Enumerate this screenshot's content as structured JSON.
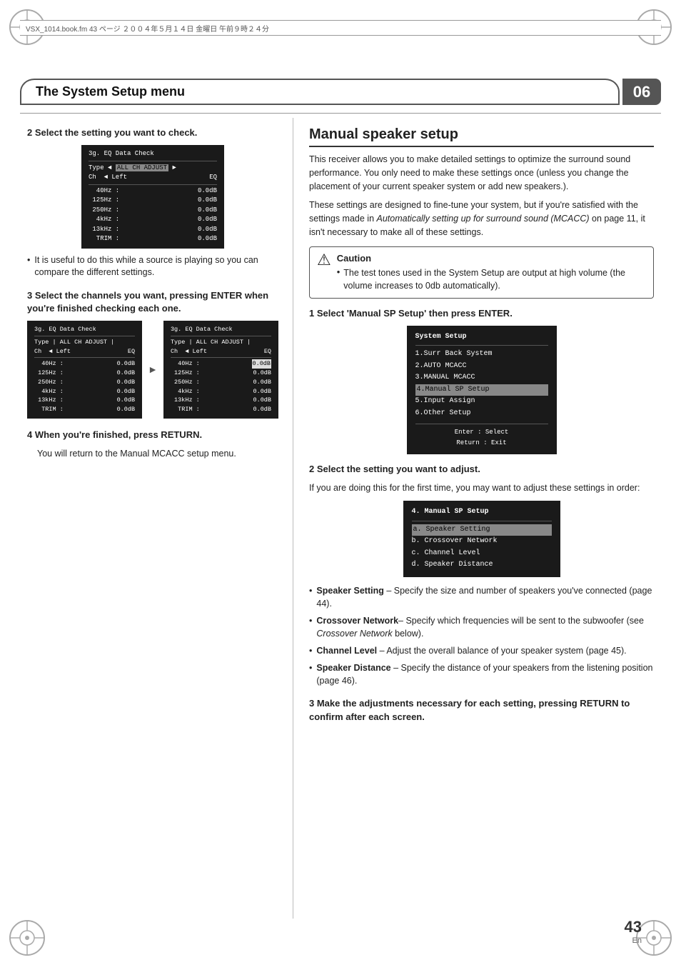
{
  "meta": {
    "file_info": "VSX_1014.book.fm  43 ページ  ２００４年５月１４日  金曜日  午前９時２４分",
    "page_number": "43",
    "page_en": "En",
    "chapter_number": "06"
  },
  "header": {
    "title": "The System Setup menu"
  },
  "left": {
    "step2": {
      "heading": "2   Select the setting you want to check.",
      "screen1": {
        "title": "3g. EQ Data Check",
        "type_line": "Type ◄ ALL CH ADJUST ►",
        "ch_line": "Ch    ◄  Left           EQ",
        "rows": [
          {
            "freq": "  40Hz :",
            "val": "0.0dB"
          },
          {
            "freq": " 125Hz :",
            "val": "0.0dB"
          },
          {
            "freq": " 250Hz :",
            "val": "0.0dB"
          },
          {
            "freq": "  4kHz :",
            "val": "0.0dB"
          },
          {
            "freq": "  13kHz :",
            "val": "0.0dB"
          },
          {
            "freq": "  TRIM :",
            "val": "0.0dB"
          }
        ]
      },
      "bullet": "It is useful to do this while a source is playing so you can compare the different settings."
    },
    "step3": {
      "heading": "3   Select the channels you want, pressing ENTER when you're finished checking each one.",
      "screen_left": {
        "title": "3g. EQ Data Check",
        "type_line": "Type | ALL CH ADJUST |",
        "ch_line": "Ch   ◄ Left           EQ",
        "rows": [
          {
            "freq": "  40Hz :",
            "val": "0.0dB"
          },
          {
            "freq": " 125Hz :",
            "val": "0.0dB"
          },
          {
            "freq": " 250Hz :",
            "val": "0.0dB"
          },
          {
            "freq": "  4kHz :",
            "val": "0.0dB"
          },
          {
            "freq": "  13kHz :",
            "val": "0.0dB"
          },
          {
            "freq": "  TRIM :",
            "val": "0.0dB"
          }
        ]
      },
      "screen_right": {
        "title": "3g. EQ Data Check",
        "type_line": "Type | ALL CH ADJUST |",
        "ch_line": "Ch   ◄ Left           EQ",
        "rows": [
          {
            "freq": "  40Hz :",
            "val_highlighted": "0.0dB"
          },
          {
            "freq": " 125Hz :",
            "val": "0.0dB"
          },
          {
            "freq": " 250Hz :",
            "val": "0.0dB"
          },
          {
            "freq": "  4kHz :",
            "val": "0.0dB"
          },
          {
            "freq": "  13kHz :",
            "val": "0.0dB"
          },
          {
            "freq": "  TRIM :",
            "val": "0.0dB"
          }
        ]
      }
    },
    "step4": {
      "heading": "4   When you're finished, press RETURN.",
      "body": "You will return to the Manual MCACC setup menu."
    }
  },
  "right": {
    "section_title": "Manual speaker setup",
    "intro1": "This receiver allows you to make detailed settings to optimize the surround sound performance. You only need to make these settings once (unless you change the placement of your current speaker system or add new speakers.).",
    "intro2": "These settings are designed to fine-tune your system, but if you're satisfied with the settings made in Automatically setting up for surround sound (MCACC) on page 11, it isn't necessary to make all of these settings.",
    "caution": {
      "title": "Caution",
      "text": "The test tones used in the System Setup are output at high volume (the volume increases to 0db automatically)."
    },
    "step1": {
      "heading": "1   Select 'Manual SP Setup' then press ENTER.",
      "system_setup_screen": {
        "title": "System Setup",
        "items": [
          "1.Surr Back System",
          "2.AUTO MCACC",
          "3.MANUAL MCACC",
          "4.Manual SP Setup",
          "5.Input Assign",
          "6.Other Setup"
        ],
        "highlighted_index": 3,
        "footer1": "Enter : Select",
        "footer2": "Return : Exit"
      }
    },
    "step2": {
      "heading": "2   Select the setting you want to adjust.",
      "body": "If you are doing this for the first time, you may want to adjust these settings in order:",
      "sp_setup_screen": {
        "title": "4. Manual SP Setup",
        "items": [
          "a. Speaker Setting",
          "b. Crossover Network",
          "c. Channel Level",
          "d. Speaker Distance"
        ],
        "highlighted_index": 0
      }
    },
    "bullets": [
      {
        "label": "Speaker Setting",
        "text": "– Specify the size and number of speakers you've connected (page 44)."
      },
      {
        "label": "Crossover Network",
        "text": "– Specify which frequencies will be sent to the subwoofer (see Crossover Network below)."
      },
      {
        "label": "Channel Level",
        "text": "– Adjust the overall balance of your speaker system (page 45)."
      },
      {
        "label": "Speaker Distance",
        "text": "– Specify the distance of your speakers from the listening position (page 46)."
      }
    ],
    "step3": {
      "heading": "3   Make the adjustments necessary for each setting, pressing RETURN to confirm after each screen."
    }
  }
}
